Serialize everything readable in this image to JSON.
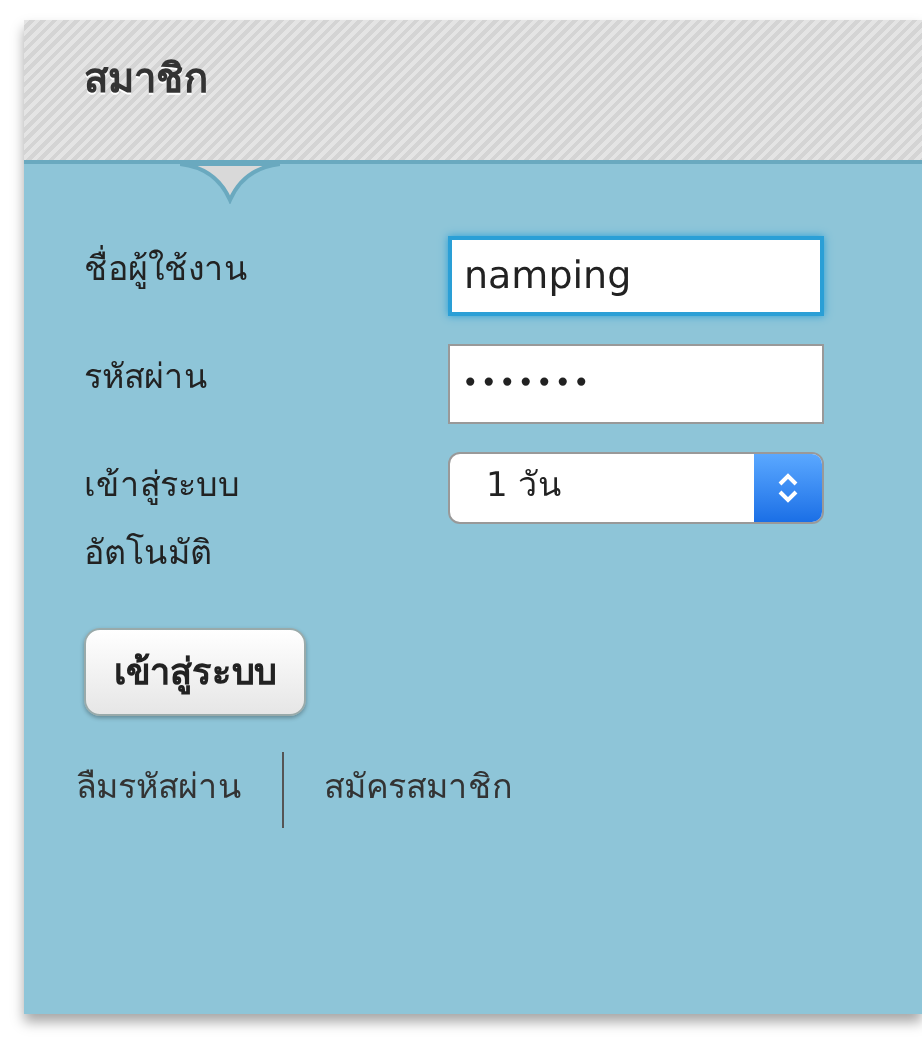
{
  "panel": {
    "title": "สมาชิก"
  },
  "fields": [
    {
      "kind": "text",
      "label": "ชื่อผู้ใช้งาน",
      "value": "namping",
      "focused": true
    },
    {
      "kind": "password",
      "label": "รหัสผ่าน",
      "value": "•••••••",
      "focused": false
    },
    {
      "kind": "select",
      "label": "เข้าสู่ระบบอัตโนมัติ",
      "value": "1 วัน",
      "focused": false
    }
  ],
  "login_button": "เข้าสู่ระบบ",
  "links": [
    "ลืมรหัสผ่าน",
    "สมัครสมาชิก"
  ]
}
